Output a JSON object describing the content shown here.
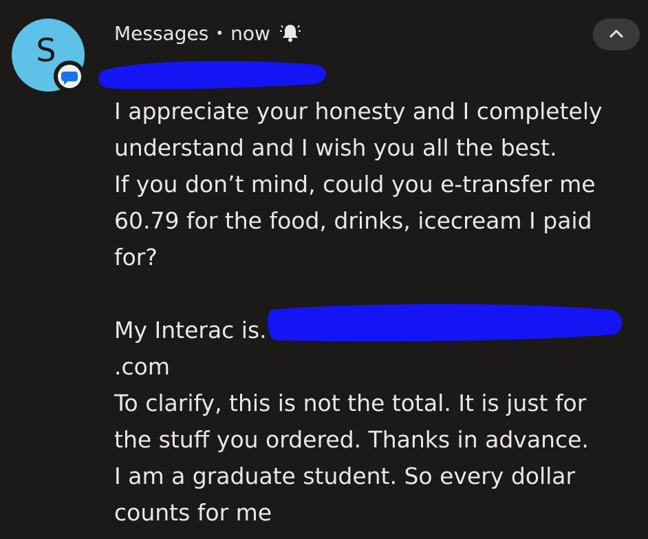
{
  "header": {
    "app_name": "Messages",
    "separator": "•",
    "time": "now"
  },
  "avatar": {
    "initial": "S",
    "color": "#5ec1e7"
  },
  "app_badge_icon": "messages-app-icon",
  "bell_icon": "bell-alert-icon",
  "expand_icon": "chevron-up-icon",
  "redaction_color": "#1414f5",
  "message": {
    "lines": [
      "I appreciate your honesty and I completely",
      "understand and I wish you all the best.",
      "If you don’t mind, could you e-transfer me",
      "60.79 for the food, drinks, icecream I paid",
      "for?",
      "",
      "My Interac is.",
      ".com",
      "To clarify, this is not the total. It is just for",
      "the stuff you ordered. Thanks in advance.",
      "I am a graduate student. So every dollar",
      "counts for me"
    ]
  }
}
